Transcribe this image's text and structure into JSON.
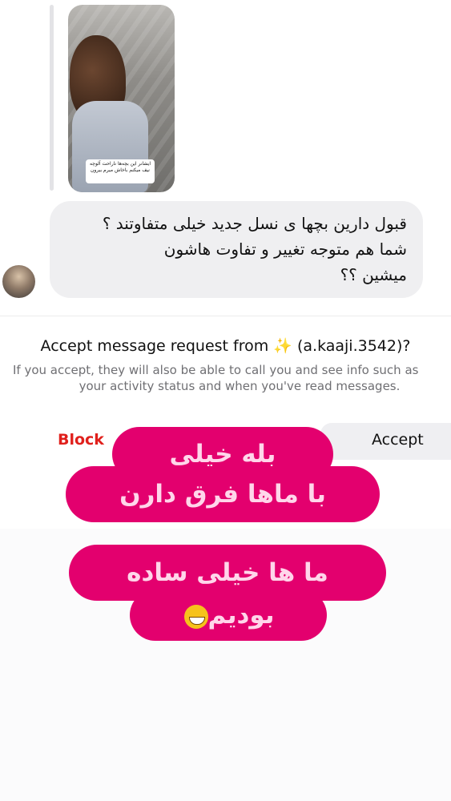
{
  "story": {
    "sticker_text": "ایشانر این بچه‌ها ناراحت آلوچه نیف میکنم باخاش میرم بیرون"
  },
  "message": {
    "lines": [
      "قبول دارین بچها ی نسل جدید خیلی متفاوتند ؟",
      "شما هم متوجه تغییر و تفاوت هاشون",
      "میشین ؟؟"
    ]
  },
  "request": {
    "title": "Accept message request from ✨ (a.kaaji.3542)?",
    "subtitle_line1": "If you accept, they will also be able to call you and see info such as",
    "subtitle_line2": "your activity status and when you've read messages."
  },
  "actions": {
    "block_label": "Block",
    "accept_label": "Accept"
  },
  "overlay_text": {
    "line1": "بله خیلی",
    "line2": "با ماها فرق دارن",
    "line3": "ما ها خیلی ساده",
    "line4": "بودیم"
  },
  "colors": {
    "sticker_pink": "#e3006e",
    "block_red": "#e0201c"
  }
}
